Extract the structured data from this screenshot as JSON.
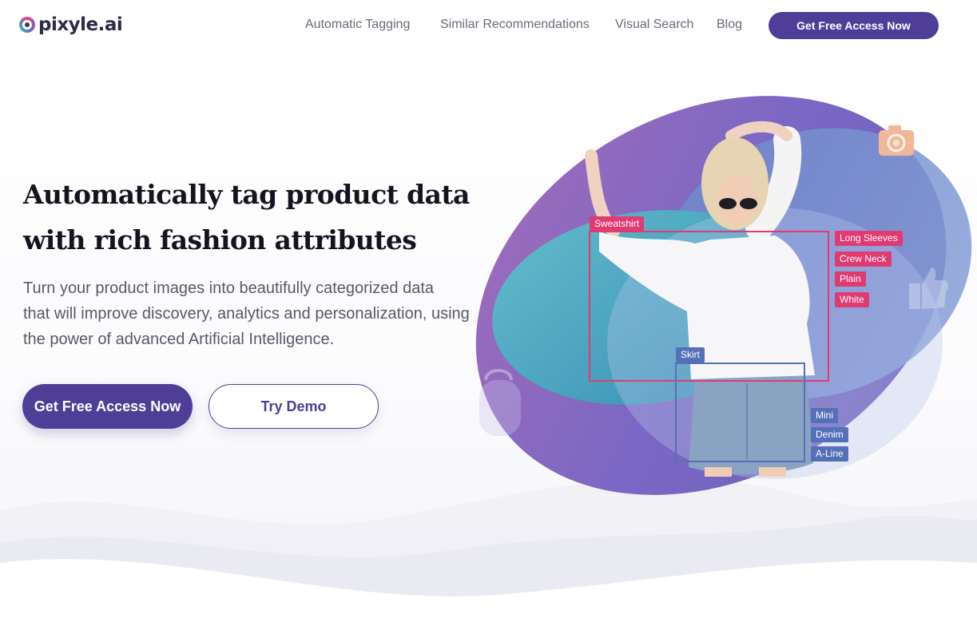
{
  "brand": {
    "name": "pixyle.ai"
  },
  "nav": {
    "items": [
      {
        "label": "Automatic Tagging"
      },
      {
        "label": "Similar Recommendations"
      },
      {
        "label": "Visual Search"
      },
      {
        "label": "Blog"
      }
    ],
    "cta_label": "Get Free Access Now"
  },
  "hero": {
    "headline_line1": "Automatically tag product data",
    "headline_line2": "with rich fashion attributes",
    "sub_line1": "Turn your product images into beautifully categorized data",
    "sub_line2": "that will improve discovery, analytics and personalization, using",
    "sub_line3": "the power of advanced Artificial Intelligence.",
    "primary_cta": "Get Free Access Now",
    "secondary_cta": "Try Demo"
  },
  "illustration": {
    "top_box_label": "Sweatshirt",
    "top_attributes": [
      "Long Sleeves",
      "Crew Neck",
      "Plain",
      "White"
    ],
    "bottom_box_label": "Skirt",
    "bottom_attributes": [
      "Mini",
      "Denim",
      "A-Line"
    ],
    "icons": [
      "camera-icon",
      "handbag-icon",
      "thumbs-up-icon"
    ]
  },
  "colors": {
    "brand_purple": "#4e3e98",
    "tag_pink": "#e03a72",
    "tag_blue": "#5570b8",
    "blob_teal": "#3aa9c0",
    "blob_purple": "#7b68c4"
  }
}
